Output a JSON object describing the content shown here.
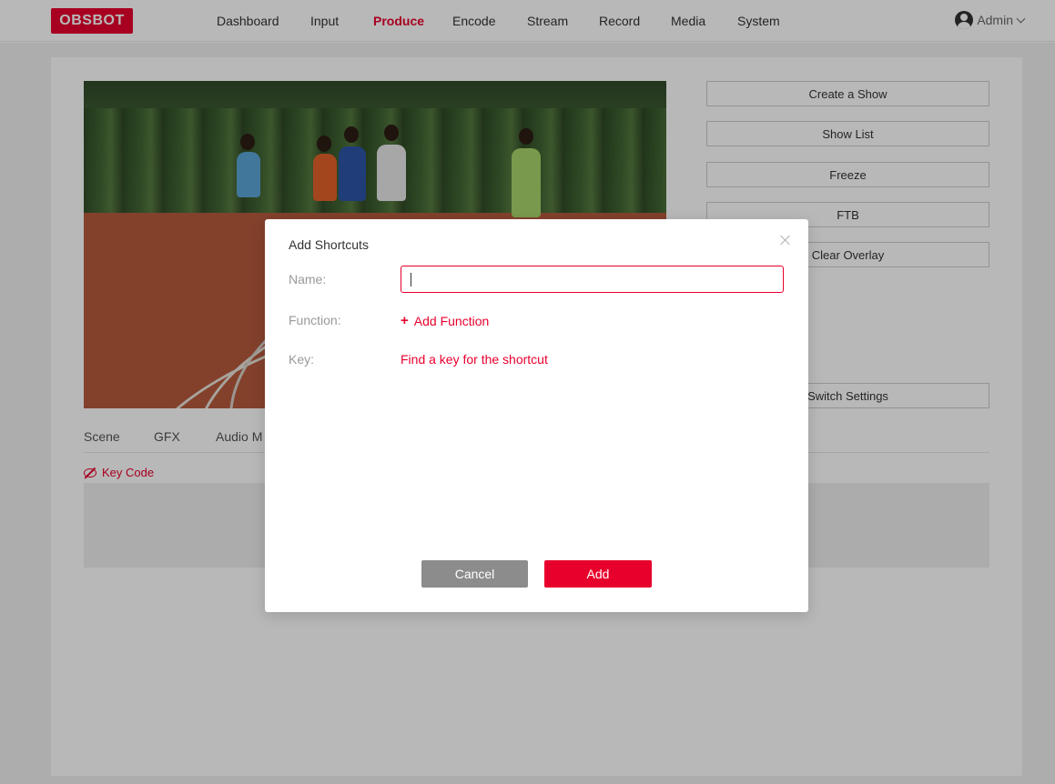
{
  "header": {
    "logo": "OBSBOT",
    "nav": [
      {
        "label": "Dashboard"
      },
      {
        "label": "Input"
      },
      {
        "label": "Produce",
        "active": true
      },
      {
        "label": "Encode"
      },
      {
        "label": "Stream"
      },
      {
        "label": "Record"
      },
      {
        "label": "Media"
      },
      {
        "label": "System"
      }
    ],
    "user": "Admin",
    "user_icon": "user-avatar-icon"
  },
  "side_buttons": {
    "create_show": "Create a Show",
    "show_list": "Show List",
    "freeze": "Freeze",
    "ftb": "FTB",
    "clear_overlay": "Clear Overlay",
    "switch_settings": "Switch Settings"
  },
  "tabs": [
    "Scene",
    "GFX",
    "Audio M"
  ],
  "key_code": "Key Code",
  "modal": {
    "title": "Add Shortcuts",
    "name_label": "Name:",
    "name_value": "",
    "function_label": "Function:",
    "add_function": "Add Function",
    "key_label": "Key:",
    "find_key": "Find a key for the shortcut",
    "cancel": "Cancel",
    "add": "Add"
  },
  "colors": {
    "accent": "#e8002d",
    "cancel_gray": "#8c8c8c"
  }
}
